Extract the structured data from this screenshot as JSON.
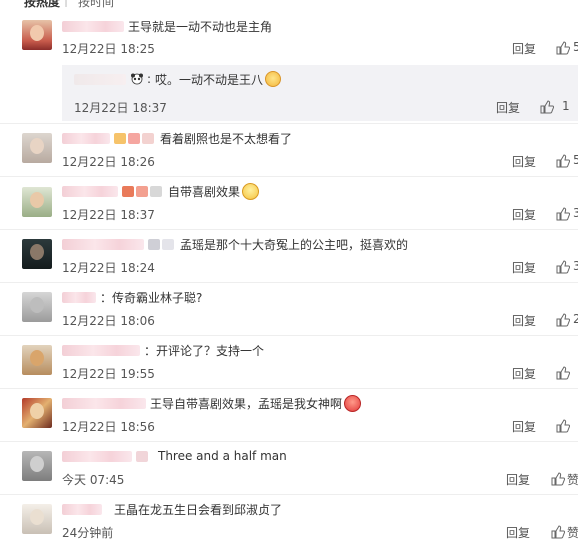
{
  "tabs": {
    "hot": "按热度",
    "divider": "|",
    "time": "按时间"
  },
  "actions": {
    "reply": "回复"
  },
  "comments": [
    {
      "text": "王导就是一动不动也是主角",
      "time": "12月22日 18:25",
      "like_count": "5",
      "subreply": {
        "text": "哎。一动不动是王八",
        "time": "12月22日 18:37",
        "like_count": "1"
      }
    },
    {
      "text": "看着剧照也是不太想看了",
      "time": "12月22日 18:26",
      "like_count": "5"
    },
    {
      "text": "自带喜剧效果",
      "time": "12月22日 18:37",
      "like_count": "3"
    },
    {
      "text": "孟瑶是那个十大奇冤上的公主吧，挺喜欢的",
      "time": "12月22日 18:24",
      "like_count": "3"
    },
    {
      "text": "：传奇霸业林子聪?",
      "time": "12月22日 18:06",
      "like_count": "2"
    },
    {
      "text": "：开评论了？支持一个",
      "time": "12月22日 19:55",
      "like_count": ""
    },
    {
      "text": "王导自带喜剧效果，孟瑶是我女神啊",
      "time": "12月22日 18:56",
      "like_count": ""
    },
    {
      "text": "Three and a half man",
      "time": "今天 07:45",
      "like_count": "赞"
    },
    {
      "text": "王晶在龙五生日会看到邱淑贞了",
      "time": "24分钟前",
      "like_count": "赞"
    }
  ]
}
